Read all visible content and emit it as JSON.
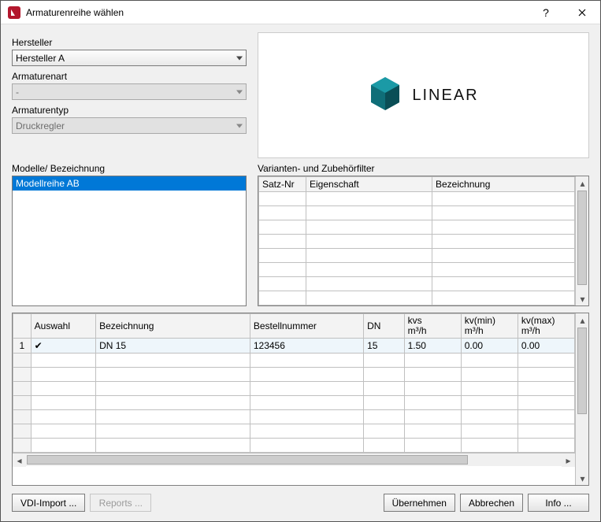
{
  "titlebar": {
    "title": "Armaturenreihe wählen"
  },
  "labels": {
    "hersteller": "Hersteller",
    "armaturenart": "Armaturenart",
    "armaturentyp": "Armaturentyp",
    "modelle": "Modelle/ Bezeichnung",
    "varianten": "Varianten- und Zubehörfilter"
  },
  "combos": {
    "hersteller_value": "Hersteller A",
    "armaturenart_value": "-",
    "armaturentyp_value": "Druckregler"
  },
  "brand": {
    "name": "LINEAR"
  },
  "models": {
    "items": [
      "Modellreihe AB"
    ],
    "selected": 0
  },
  "variant_headers": {
    "satznr": "Satz-Nr",
    "eigenschaft": "Eigenschaft",
    "bezeichnung": "Bezeichnung"
  },
  "main_headers": {
    "rownum": "",
    "auswahl": "Auswahl",
    "bezeichnung": "Bezeichnung",
    "bestellnummer": "Bestellnummer",
    "dn": "DN",
    "kvs": "kvs",
    "kvs_unit": "m³/h",
    "kvmin": "kv(min)",
    "kvmin_unit": "m³/h",
    "kvmax": "kv(max)",
    "kvmax_unit": "m³/h"
  },
  "main_rows": [
    {
      "num": "1",
      "checked": true,
      "bezeichnung": "DN 15",
      "bestellnummer": "123456",
      "dn": "15",
      "kvs": "1.50",
      "kvmin": "0.00",
      "kvmax": "0.00"
    }
  ],
  "buttons": {
    "vdi": "VDI-Import ...",
    "reports": "Reports ...",
    "uebernehmen": "Übernehmen",
    "abbrechen": "Abbrechen",
    "info": "Info ..."
  }
}
